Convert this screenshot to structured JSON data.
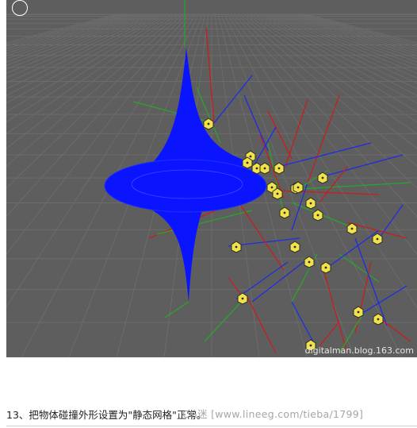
{
  "viewport": {
    "watermark": "digitalman.blog.163.com",
    "colors": {
      "background": "#5e5e5e",
      "grid": "#6c6c6c",
      "object": "#0a14ff",
      "marker": "#f2e24a",
      "line_red": "#c81e1e",
      "line_green": "#2aa52a",
      "line_blue": "#1e2ee0"
    }
  },
  "caption": {
    "text": "13、把物体碰撞外形设置为\"静态网格\"正常。"
  },
  "overlay_watermark": "CG迷 [www.lineeg.com/tieba/1799]"
}
